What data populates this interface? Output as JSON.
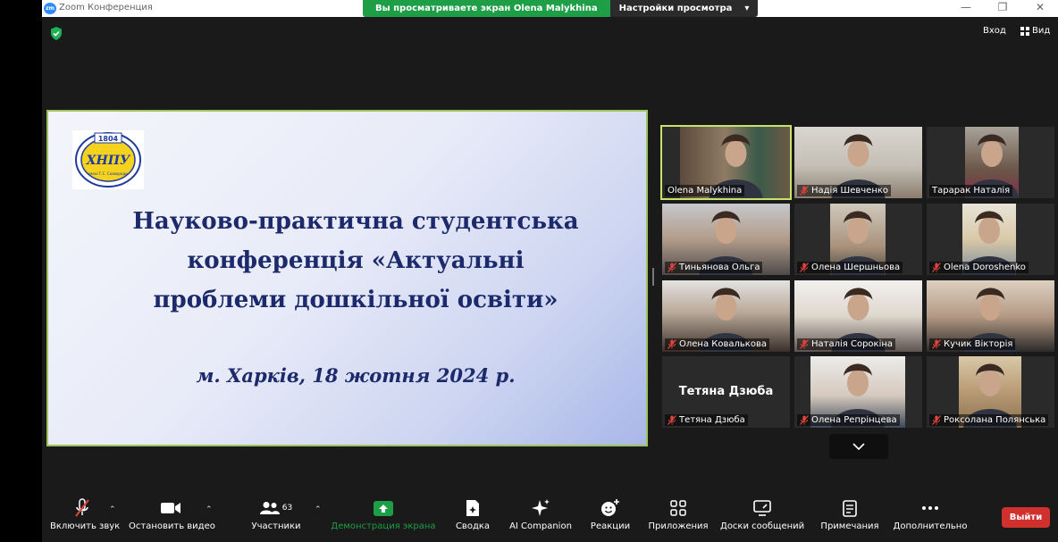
{
  "window": {
    "title": "Zoom Конференция",
    "logo_text": "zm",
    "controls": [
      "—",
      "❐",
      "✕"
    ]
  },
  "banner": {
    "viewing_text": "Вы просматриваете экран Olena Malykhina",
    "settings_label": "Настройки просмотра",
    "settings_chevron": "▾"
  },
  "top_controls": {
    "enter_label": "Вход",
    "view_label": "Вид"
  },
  "slide": {
    "title_line1": "Науково-практична студентська",
    "title_line2": "конференція «Актуальні",
    "title_line3": "проблеми дошкільної освіти»",
    "subtitle": "м. Харків,  18 жотня 2024 р.",
    "logo": {
      "year": "1804",
      "letters": "ХНПУ",
      "motto": "імені Г.С. Сковороди"
    }
  },
  "participants": [
    {
      "name": "Olena Malykhina",
      "muted": false,
      "active": true,
      "video": true
    },
    {
      "name": "Надія Шевченко",
      "muted": true,
      "active": false,
      "video": true
    },
    {
      "name": "Тарарак  Наталія",
      "muted": false,
      "active": false,
      "video": true
    },
    {
      "name": "Тиньянова Ольга",
      "muted": true,
      "active": false,
      "video": true
    },
    {
      "name": "Олена Шершньова",
      "muted": true,
      "active": false,
      "video": true
    },
    {
      "name": "Olena Doroshenko",
      "muted": true,
      "active": false,
      "video": true
    },
    {
      "name": "Олена Ковалькова",
      "muted": true,
      "active": false,
      "video": true
    },
    {
      "name": "Наталія Сорокіна",
      "muted": true,
      "active": false,
      "video": true
    },
    {
      "name": "Кучик Вікторія",
      "muted": true,
      "active": false,
      "video": true
    },
    {
      "name": "Тетяна Дзюба",
      "muted": true,
      "active": false,
      "video": false,
      "display_name": "Тетяна Дзюба"
    },
    {
      "name": "Олена Репрінцева",
      "muted": true,
      "active": false,
      "video": true
    },
    {
      "name": "Роксолана Полянська",
      "muted": true,
      "active": false,
      "video": true
    }
  ],
  "toolbar": {
    "audio_label": "Включить звук",
    "video_label": "Остановить видео",
    "participants_label": "Участники",
    "participants_count": "63",
    "share_label": "Демонстрация экрана",
    "summary_label": "Сводка",
    "ai_label": "AI Companion",
    "reactions_label": "Реакции",
    "apps_label": "Приложения",
    "whiteboards_label": "Доски сообщений",
    "notes_label": "Примечания",
    "more_label": "Дополнительно",
    "leave_label": "Выйти",
    "caret": "⌃"
  },
  "colors": {
    "share_green": "#1e9e47",
    "leave_red": "#d0312d",
    "active_outline": "#c8e36b",
    "slide_text": "#1c2a6b",
    "mic_off_red": "#e0443e"
  }
}
